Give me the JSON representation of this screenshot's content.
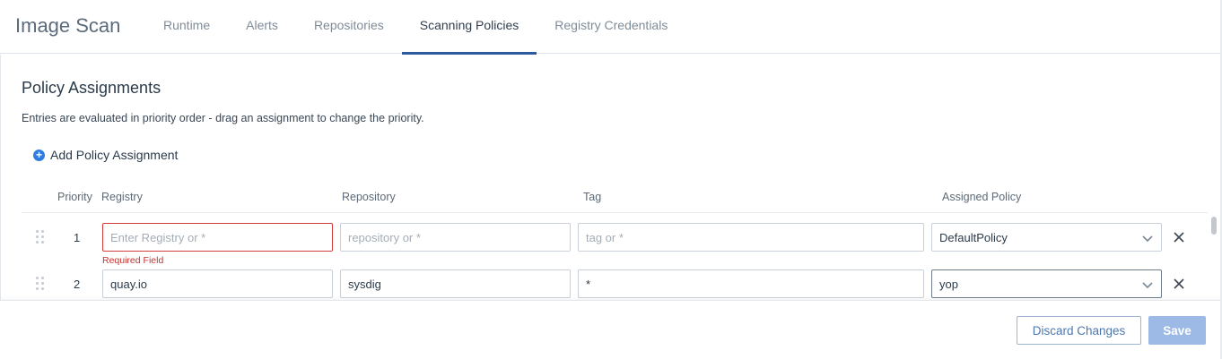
{
  "app_title": "Image Scan",
  "tabs": [
    {
      "label": "Runtime",
      "active": false
    },
    {
      "label": "Alerts",
      "active": false
    },
    {
      "label": "Repositories",
      "active": false
    },
    {
      "label": "Scanning Policies",
      "active": true
    },
    {
      "label": "Registry Credentials",
      "active": false
    }
  ],
  "section": {
    "title": "Policy Assignments",
    "description": "Entries are evaluated in priority order - drag an assignment to change the priority.",
    "add_label": "Add Policy Assignment"
  },
  "table": {
    "headers": {
      "priority": "Priority",
      "registry": "Registry",
      "repository": "Repository",
      "tag": "Tag",
      "policy": "Assigned Policy"
    },
    "rows": [
      {
        "priority": "1",
        "registry": "",
        "registry_placeholder": "Enter Registry or *",
        "registry_error": "Required Field",
        "repository": "",
        "repository_placeholder": "repository or *",
        "tag": "",
        "tag_placeholder": "tag or *",
        "policy": "DefaultPolicy"
      },
      {
        "priority": "2",
        "registry": "quay.io",
        "repository": "sysdig",
        "tag": "*",
        "policy": "yop"
      }
    ]
  },
  "footer": {
    "discard_label": "Discard Changes",
    "save_label": "Save"
  },
  "icons": {
    "add": "plus-circle-icon",
    "drag": "drag-handle-icon",
    "dropdown": "chevron-down-icon",
    "remove": "close-icon"
  },
  "colors": {
    "accent": "#2c5aa0",
    "error": "#d23c3c",
    "save_disabled": "#9db9e6",
    "add_icon": "#2f7de1"
  }
}
